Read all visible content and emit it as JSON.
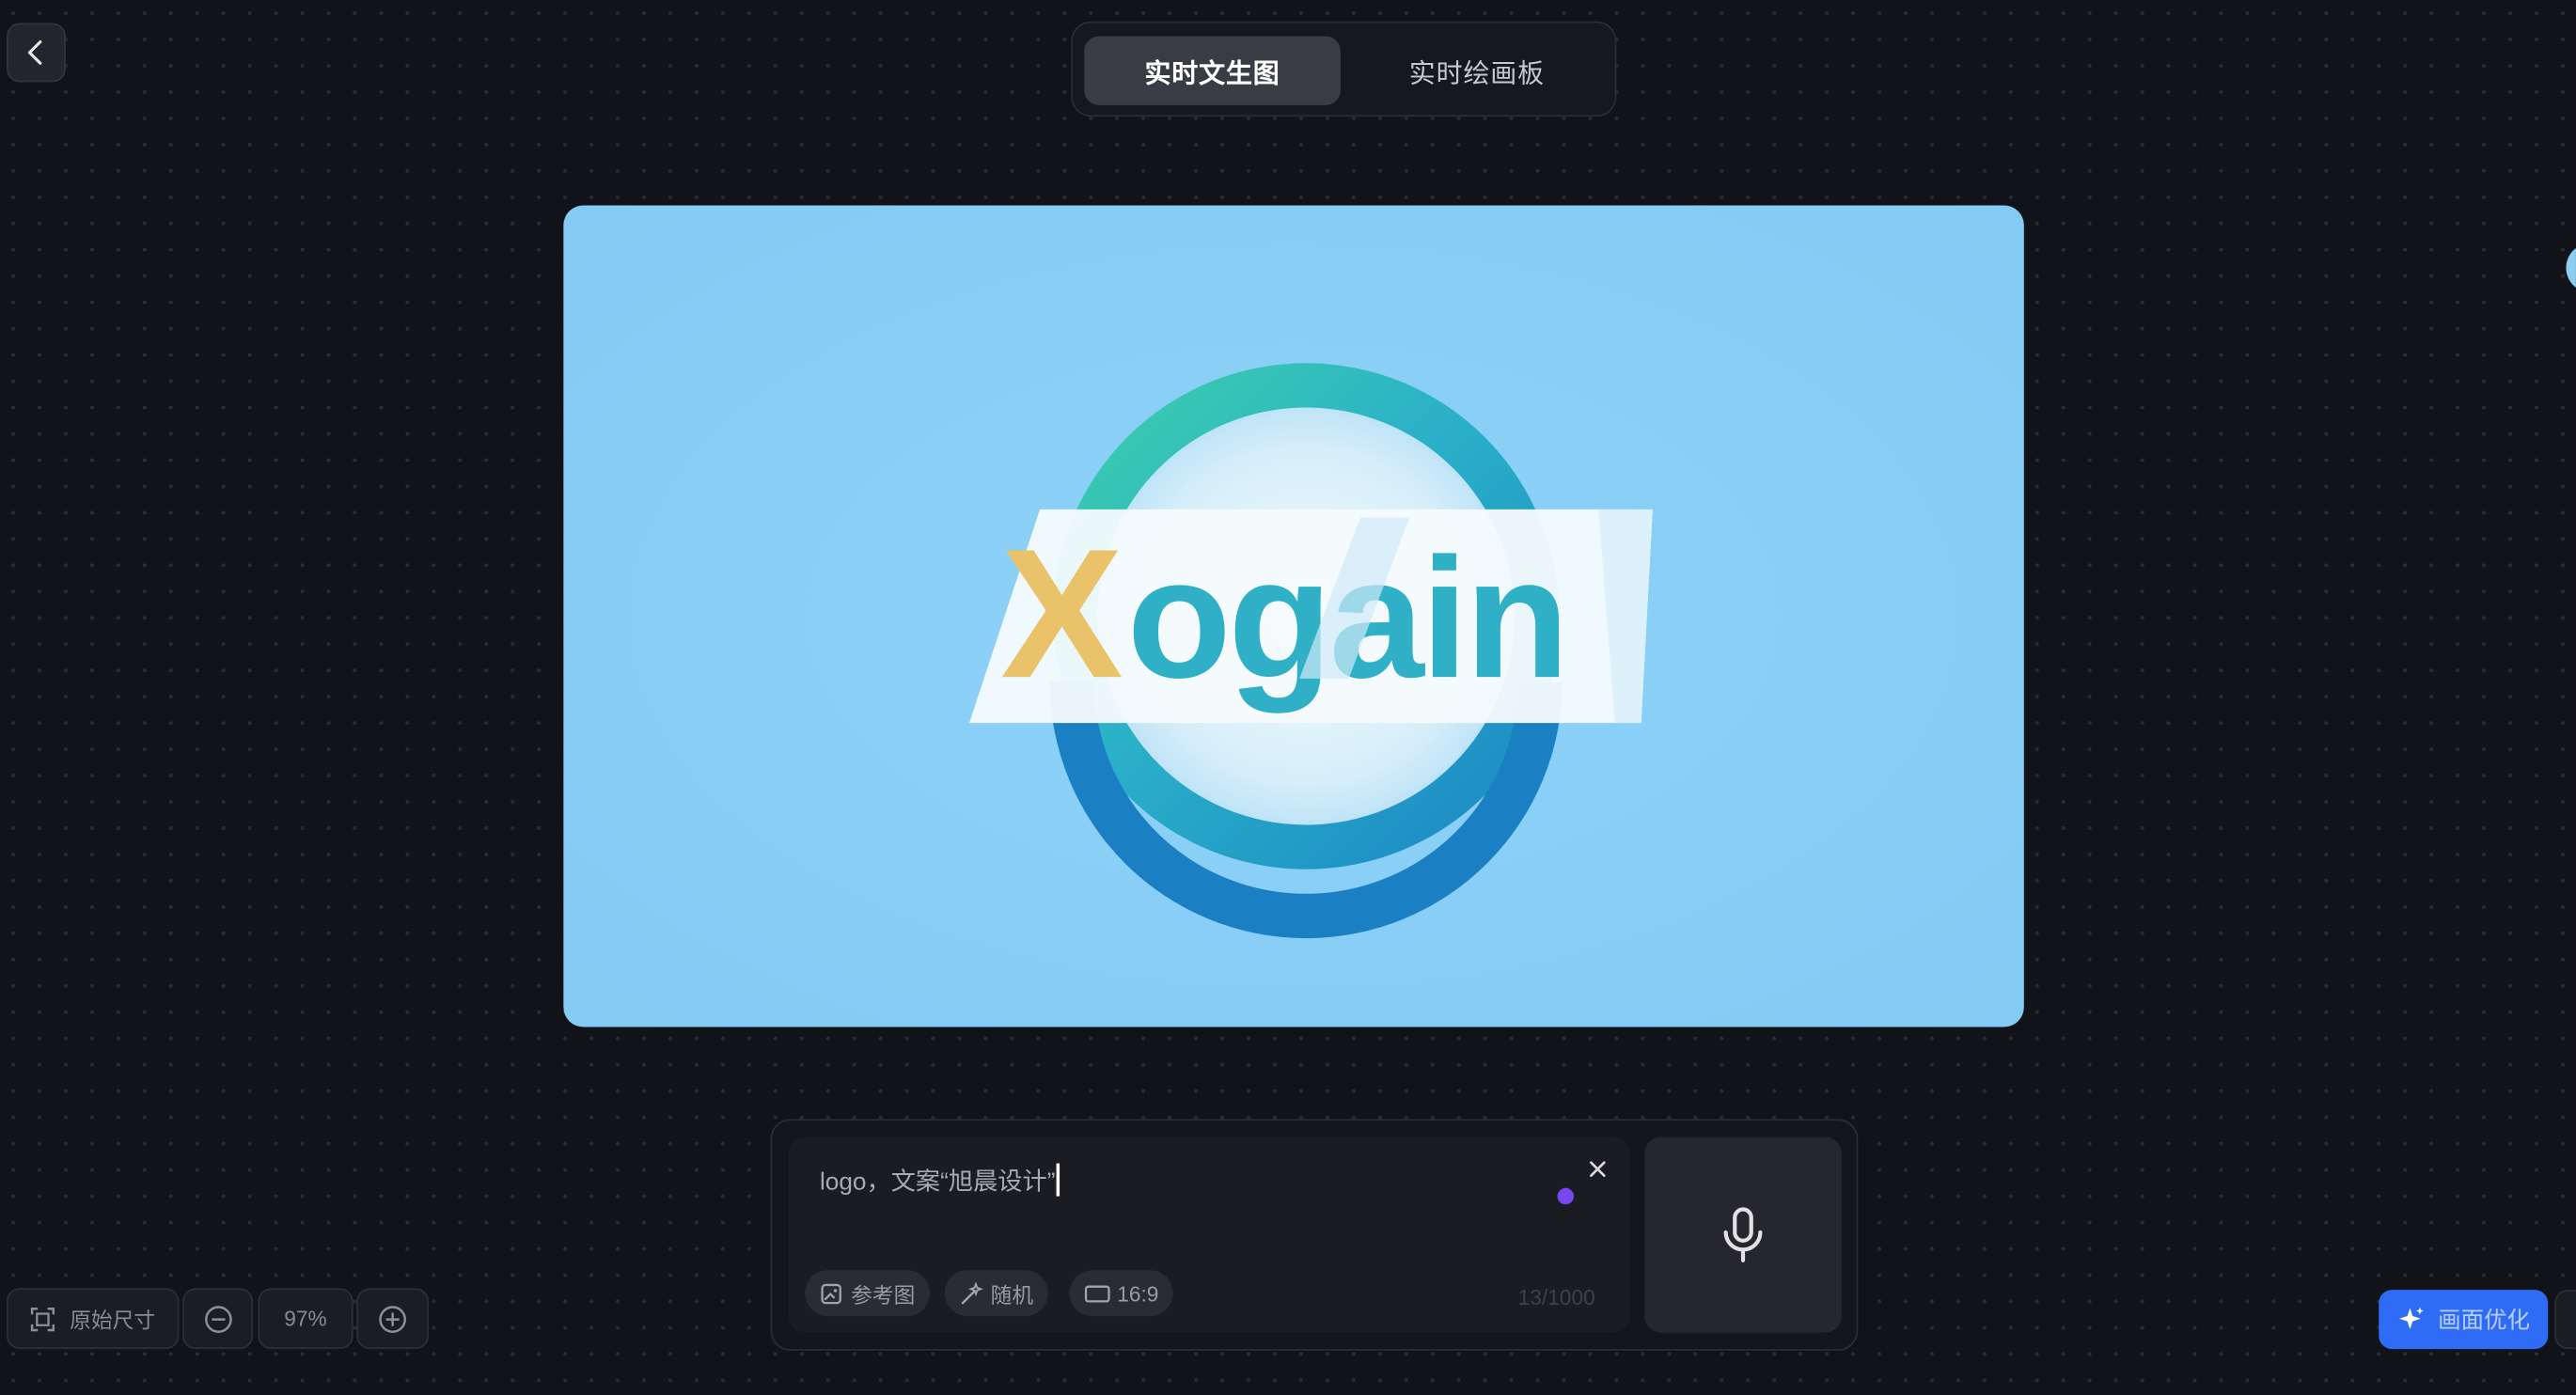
{
  "header": {
    "tabs": [
      {
        "label": "实时文生图",
        "active": true
      },
      {
        "label": "实时绘画板",
        "active": false
      }
    ]
  },
  "canvas": {
    "image_logo_text": "Xogain",
    "background_color": "#88cef6"
  },
  "prompt": {
    "text": "logo，文案“旭晨设计”",
    "char_count": "13/1000",
    "chips": {
      "reference_label": "参考图",
      "random_label": "随机",
      "ratio_label": "16:9"
    },
    "clear_icon": "close-icon",
    "mic_icon": "microphone-icon"
  },
  "zoom": {
    "original_size_label": "原始尺寸",
    "value": "97%"
  },
  "optimize": {
    "label": "画面优化",
    "color": "#2e6cf5"
  }
}
